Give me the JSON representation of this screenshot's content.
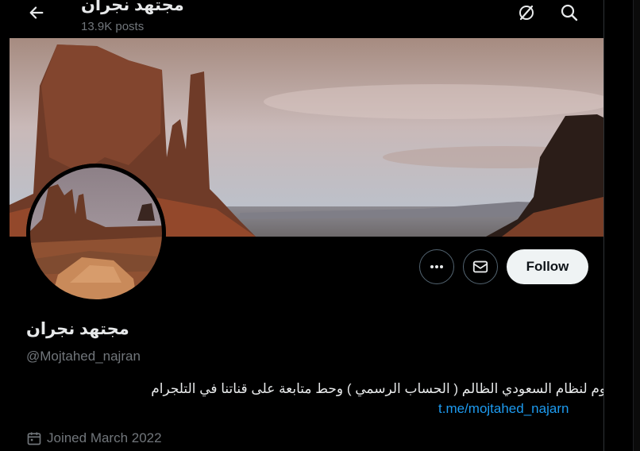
{
  "header": {
    "title": "مجتهد نجران",
    "posts_count": "13.9K posts",
    "back_icon": "arrow-left-icon",
    "icons": [
      "grok-icon",
      "search-icon"
    ]
  },
  "profile": {
    "display_name": "مجتهد نجران",
    "handle": "@Mojtahed_najran",
    "bio": "مقاوم لنظام السعودي الظالم ( الحساب الرسمي ) وحط متابعة على قناتنا في التلجرام",
    "bio_link": "t.me/mojtahed_najarn",
    "joined": "Joined March 2022"
  },
  "actions": {
    "more_icon": "ellipsis-icon",
    "message_icon": "envelope-icon",
    "follow_label": "Follow"
  },
  "colors": {
    "background": "#000000",
    "text": "#e7e9ea",
    "muted": "#71767b",
    "link": "#1d9bf0",
    "follow_bg": "#eff3f4"
  }
}
